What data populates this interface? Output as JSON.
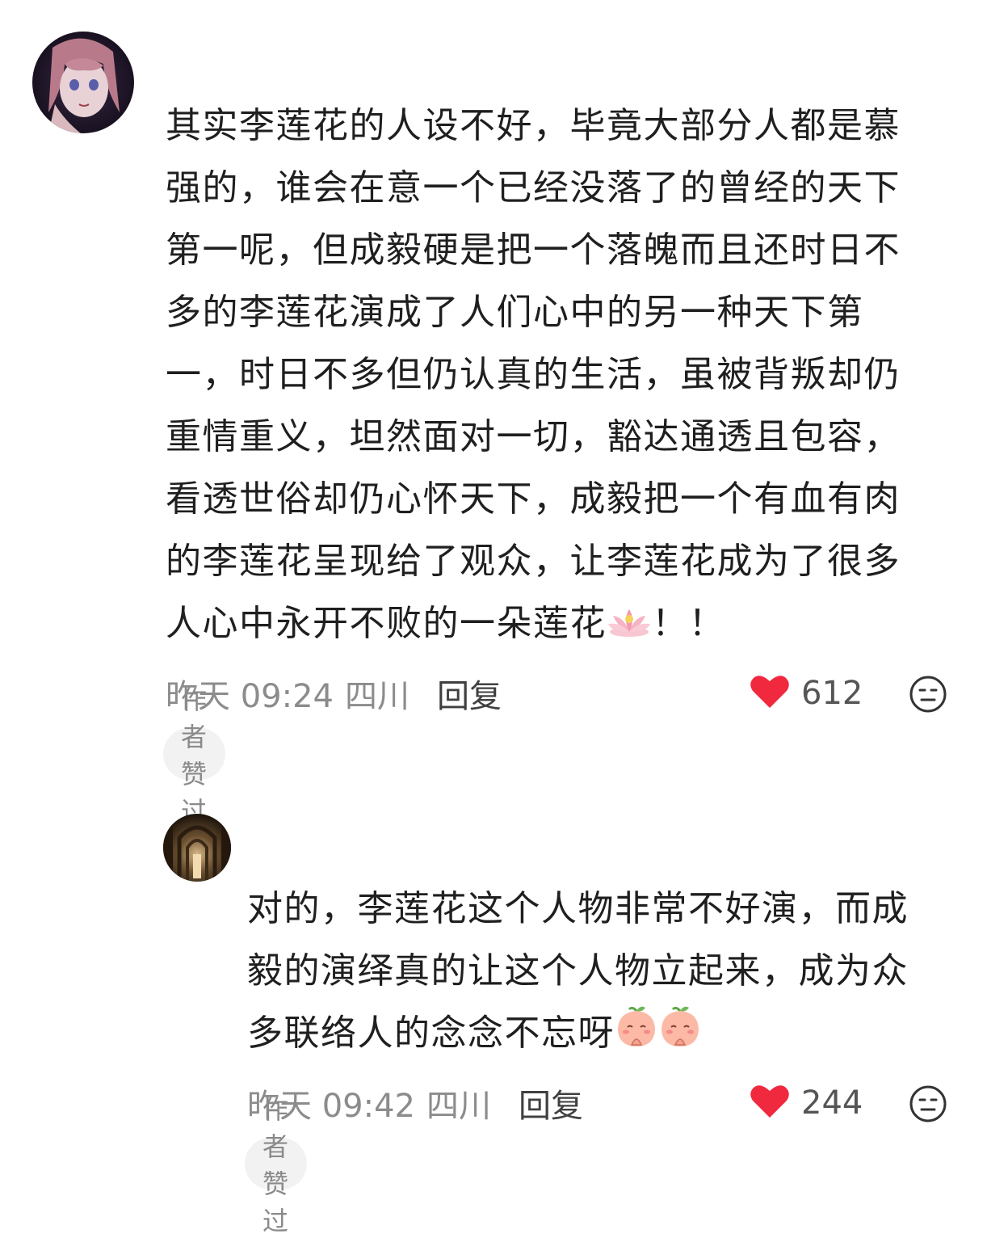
{
  "comments": [
    {
      "text_lines": [
        "其实李莲花的人设不好，毕竟大部分人都是慕",
        "强的，谁会在意一个已经没落了的曾经的天下",
        "第一呢，但成毅硬是把一个落魄而且还时日不",
        "多的李莲花演成了人们心中的另一种天下第",
        "一，时日不多但仍认真的生活，虽被背叛却仍",
        "重情重义，坦然面对一切，豁达通透且包容，",
        "看透世俗却仍心怀天下，成毅把一个有血有肉",
        "的李莲花呈现给了观众，让李莲花成为了很多",
        "人心中永开不败的一朵莲花"
      ],
      "text_tail": "！！",
      "emoji": "lotus-emoji",
      "time": "昨天 09:24",
      "location": "四川",
      "reply_label": "回复",
      "likes": "612",
      "badge": "作者赞过"
    },
    {
      "text_lines": [
        "对的，李莲花这个人物非常不好演，而成",
        "毅的演绎真的让这个人物立起来，成为众",
        "多联络人的念念不忘呀"
      ],
      "emoji": "peach-pray-emoji",
      "time": "昨天 09:42",
      "location": "四川",
      "reply_label": "回复",
      "likes": "244",
      "badge": "作者赞过"
    }
  ],
  "colors": {
    "heart": "#f0293e",
    "meta": "#8c8c8c",
    "badge_bg": "#f2f2f2"
  },
  "icons": {
    "like": "heart-icon",
    "react": "neutral-face-icon"
  }
}
